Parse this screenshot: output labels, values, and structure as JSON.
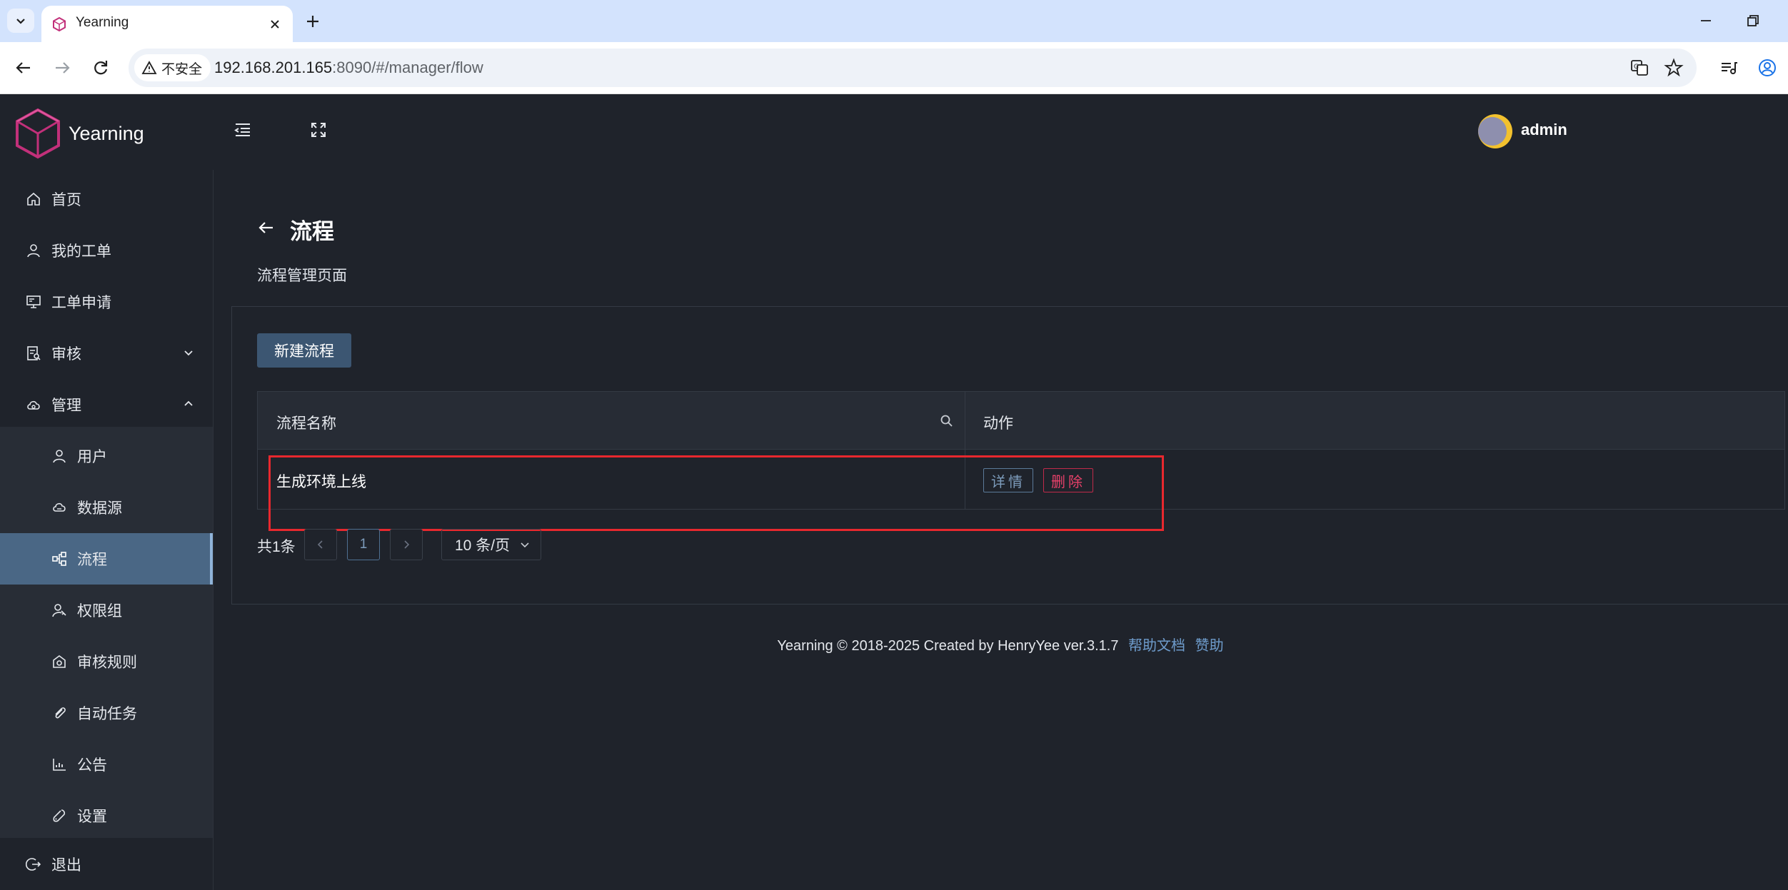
{
  "browser": {
    "tab_title": "Yearning",
    "security_label": "不安全",
    "url_host": "192.168.201.165",
    "url_rest": ":8090/#/manager/flow"
  },
  "app": {
    "brand": "Yearning",
    "user": "admin"
  },
  "sidebar": {
    "items": [
      {
        "label": "首页",
        "icon": "home-icon"
      },
      {
        "label": "我的工单",
        "icon": "user-icon"
      },
      {
        "label": "工单申请",
        "icon": "monitor-icon"
      },
      {
        "label": "审核",
        "icon": "audit-icon"
      },
      {
        "label": "管理",
        "icon": "cloud-gear-icon"
      }
    ],
    "sub_items": [
      {
        "label": "用户",
        "icon": "user-icon"
      },
      {
        "label": "数据源",
        "icon": "datasource-icon"
      },
      {
        "label": "流程",
        "icon": "flow-icon"
      },
      {
        "label": "权限组",
        "icon": "permission-icon"
      },
      {
        "label": "审核规则",
        "icon": "rule-icon"
      },
      {
        "label": "自动任务",
        "icon": "paperclip-icon"
      },
      {
        "label": "公告",
        "icon": "chart-icon"
      },
      {
        "label": "设置",
        "icon": "wrench-icon"
      }
    ],
    "logout": "退出"
  },
  "page": {
    "title": "流程",
    "subtitle": "流程管理页面",
    "new_button": "新建流程"
  },
  "table": {
    "headers": [
      "流程名称",
      "动作"
    ],
    "rows": [
      {
        "name": "生成环境上线",
        "detail": "详情",
        "delete": "删除"
      }
    ]
  },
  "pagination": {
    "total": "共1条",
    "current_page": "1",
    "page_size": "10 条/页"
  },
  "footer": {
    "text": "Yearning © 2018-2025 Created by HenryYee ver.3.1.7",
    "help_link": "帮助文档",
    "sponsor_link": "赞助"
  },
  "colors": {
    "background": "#1f232b",
    "active_menu": "#4a6785",
    "primary_button": "#3c5672",
    "danger": "#e8416a",
    "highlight": "#e8282e"
  }
}
